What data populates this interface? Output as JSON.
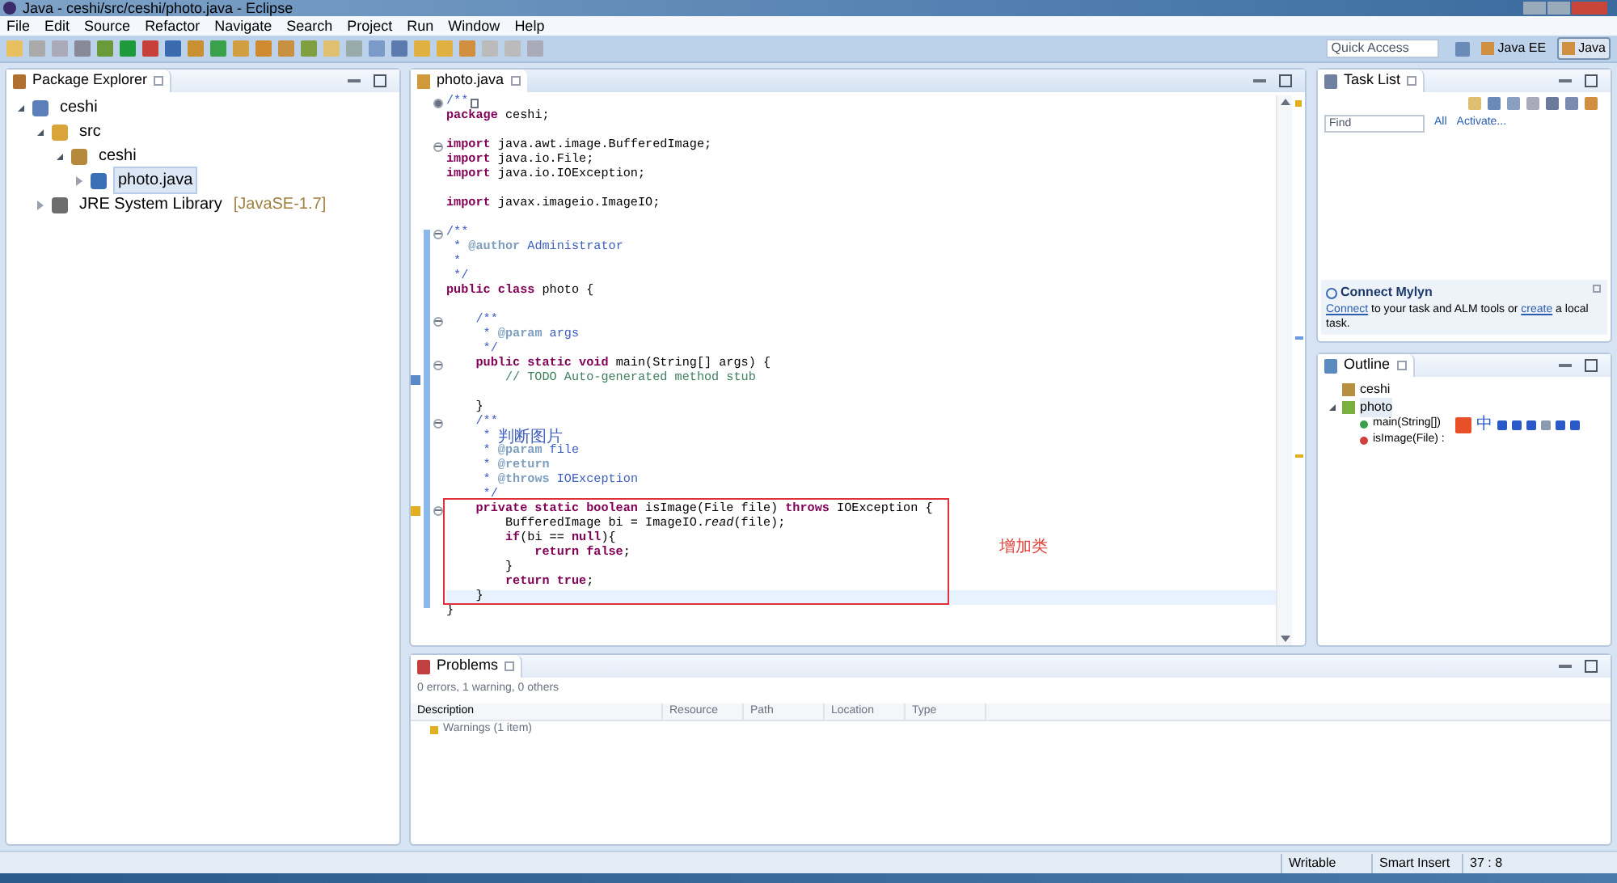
{
  "window": {
    "title": "Java - ceshi/src/ceshi/photo.java - Eclipse"
  },
  "menu": [
    "File",
    "Edit",
    "Source",
    "Refactor",
    "Navigate",
    "Search",
    "Project",
    "Run",
    "Window",
    "Help"
  ],
  "quick_access": {
    "placeholder": "Quick Access"
  },
  "perspectives": [
    {
      "label": "Java EE",
      "selected": false
    },
    {
      "label": "Java",
      "selected": true
    }
  ],
  "package_explorer": {
    "title": "Package Explorer",
    "tree": [
      {
        "label": "ceshi",
        "kind": "project",
        "expanded": true,
        "selected": false,
        "children": [
          {
            "label": "src",
            "kind": "folder",
            "expanded": true,
            "selected": false,
            "children": [
              {
                "label": "ceshi",
                "kind": "package",
                "expanded": true,
                "selected": false,
                "children": [
                  {
                    "label": "photo.java",
                    "kind": "file",
                    "expanded": false,
                    "selected": true
                  }
                ]
              }
            ]
          },
          {
            "label": "JRE System Library",
            "note": "[JavaSE-1.7]",
            "kind": "library",
            "expanded": false,
            "selected": false
          }
        ]
      }
    ]
  },
  "editor": {
    "tab": "photo.java",
    "blocks": [
      {
        "lines": [
          {
            "folded": true,
            "segments": [
              {
                "kind": "doc",
                "text": "/**"
              }
            ]
          },
          {
            "segments": [
              {
                "kind": "kw",
                "text": "package"
              },
              {
                "kind": "plain",
                "text": " ceshi;"
              }
            ]
          }
        ]
      },
      {
        "lines": [
          {
            "folded": false,
            "segments": [
              {
                "kind": "kw",
                "text": "import"
              },
              {
                "kind": "plain",
                "text": " java.awt.image.BufferedImage;"
              }
            ]
          },
          {
            "segments": [
              {
                "kind": "kw",
                "text": "import"
              },
              {
                "kind": "plain",
                "text": " java.io.File;"
              }
            ]
          },
          {
            "segments": [
              {
                "kind": "kw",
                "text": "import"
              },
              {
                "kind": "plain",
                "text": " java.io.IOException;"
              }
            ]
          }
        ]
      },
      {
        "lines": [
          {
            "segments": [
              {
                "kind": "kw",
                "text": "import"
              },
              {
                "kind": "plain",
                "text": " javax.imageio.ImageIO;"
              }
            ]
          }
        ]
      },
      {
        "lines": [
          {
            "folded": false,
            "segments": [
              {
                "kind": "doc",
                "text": "/**"
              }
            ]
          },
          {
            "segments": [
              {
                "kind": "doc",
                "text": " * "
              },
              {
                "kind": "doctag",
                "text": "@author"
              },
              {
                "kind": "doc",
                "text": " Administrator"
              }
            ]
          },
          {
            "segments": [
              {
                "kind": "doc",
                "text": " *"
              }
            ]
          },
          {
            "segments": [
              {
                "kind": "doc",
                "text": " */"
              }
            ]
          },
          {
            "segments": [
              {
                "kind": "kw",
                "text": "public class"
              },
              {
                "kind": "plain",
                "text": " photo {"
              }
            ]
          }
        ]
      },
      {
        "lines": [
          {
            "folded": false,
            "segments": [
              {
                "kind": "doc",
                "text": "    /**"
              }
            ]
          },
          {
            "segments": [
              {
                "kind": "doc",
                "text": "     * "
              },
              {
                "kind": "doctag",
                "text": "@param"
              },
              {
                "kind": "doc",
                "text": " args"
              }
            ]
          },
          {
            "segments": [
              {
                "kind": "doc",
                "text": "     */"
              }
            ]
          },
          {
            "folded": false,
            "segments": [
              {
                "kind": "kw",
                "text": "    public static void"
              },
              {
                "kind": "plain",
                "text": " main(String[] args) {"
              }
            ]
          },
          {
            "task": true,
            "segments": [
              {
                "kind": "comment",
                "text": "        // TODO Auto-generated method stub"
              }
            ]
          }
        ]
      },
      {
        "lines": [
          {
            "segments": [
              {
                "kind": "plain",
                "text": "    }"
              }
            ]
          },
          {
            "folded": false,
            "segments": [
              {
                "kind": "doc",
                "text": "    /**"
              }
            ]
          },
          {
            "segments": [
              {
                "kind": "doc",
                "text": "     * "
              },
              {
                "kind": "cjk",
                "text": "判断图片"
              }
            ]
          },
          {
            "segments": [
              {
                "kind": "doc",
                "text": "     * "
              },
              {
                "kind": "doctag",
                "text": "@param"
              },
              {
                "kind": "doc",
                "text": " file"
              }
            ]
          },
          {
            "segments": [
              {
                "kind": "doc",
                "text": "     * "
              },
              {
                "kind": "doctag",
                "text": "@return"
              }
            ]
          },
          {
            "segments": [
              {
                "kind": "doc",
                "text": "     * "
              },
              {
                "kind": "doctag",
                "text": "@throws"
              },
              {
                "kind": "doc",
                "text": " IOException"
              }
            ]
          },
          {
            "segments": [
              {
                "kind": "doc",
                "text": "     */"
              }
            ]
          },
          {
            "folded": false,
            "warning": true,
            "segments": [
              {
                "kind": "kw",
                "text": "    private static boolean"
              },
              {
                "kind": "plain",
                "text": " isImage(File file) "
              },
              {
                "kind": "kw",
                "text": "throws"
              },
              {
                "kind": "plain",
                "text": " IOException {"
              }
            ]
          },
          {
            "segments": [
              {
                "kind": "plain",
                "text": "        BufferedImage bi = ImageIO."
              },
              {
                "kind": "italic",
                "text": "read"
              },
              {
                "kind": "plain",
                "text": "(file);"
              }
            ]
          },
          {
            "segments": [
              {
                "kind": "kw",
                "text": "        if"
              },
              {
                "kind": "plain",
                "text": "(bi == "
              },
              {
                "kind": "kw",
                "text": "null"
              },
              {
                "kind": "plain",
                "text": "){"
              }
            ]
          },
          {
            "segments": [
              {
                "kind": "kw",
                "text": "            return false"
              },
              {
                "kind": "plain",
                "text": ";"
              }
            ]
          },
          {
            "segments": [
              {
                "kind": "plain",
                "text": "        }"
              }
            ]
          },
          {
            "segments": [
              {
                "kind": "kw",
                "text": "        return true"
              },
              {
                "kind": "plain",
                "text": ";"
              }
            ]
          },
          {
            "current": true,
            "segments": [
              {
                "kind": "plain",
                "text": "    }"
              }
            ]
          },
          {
            "segments": [
              {
                "kind": "plain",
                "text": "}"
              }
            ]
          }
        ]
      }
    ],
    "annotation": {
      "label": "增加类"
    }
  },
  "task_list": {
    "title": "Task List",
    "find": {
      "placeholder": "Find"
    },
    "links": [
      "All",
      "Activate..."
    ]
  },
  "mylyn": {
    "title": "Connect Mylyn",
    "text": [
      {
        "kind": "link",
        "text": "Connect"
      },
      {
        "kind": "text",
        "text": " to your task and ALM tools or "
      },
      {
        "kind": "link",
        "text": "create"
      },
      {
        "kind": "text",
        "text": " a local task."
      }
    ]
  },
  "outline": {
    "title": "Outline",
    "items": [
      {
        "label": "ceshi",
        "kind": "package"
      },
      {
        "label": "photo",
        "kind": "class",
        "expanded": true,
        "children": [
          {
            "label": "main(String[])",
            "kind": "public-method"
          },
          {
            "label": "isImage(File) :",
            "kind": "private-method"
          }
        ]
      }
    ]
  },
  "ime_bar": {
    "label": "中"
  },
  "problems": {
    "tab": "Problems",
    "summary": "0 errors, 1 warning, 0 others",
    "columns": [
      "Description",
      "Resource",
      "Path",
      "Location",
      "Type"
    ],
    "rows": [
      "Warnings (1 item)"
    ]
  },
  "status_bar": [
    "Writable",
    "Smart Insert",
    "37 : 8"
  ]
}
